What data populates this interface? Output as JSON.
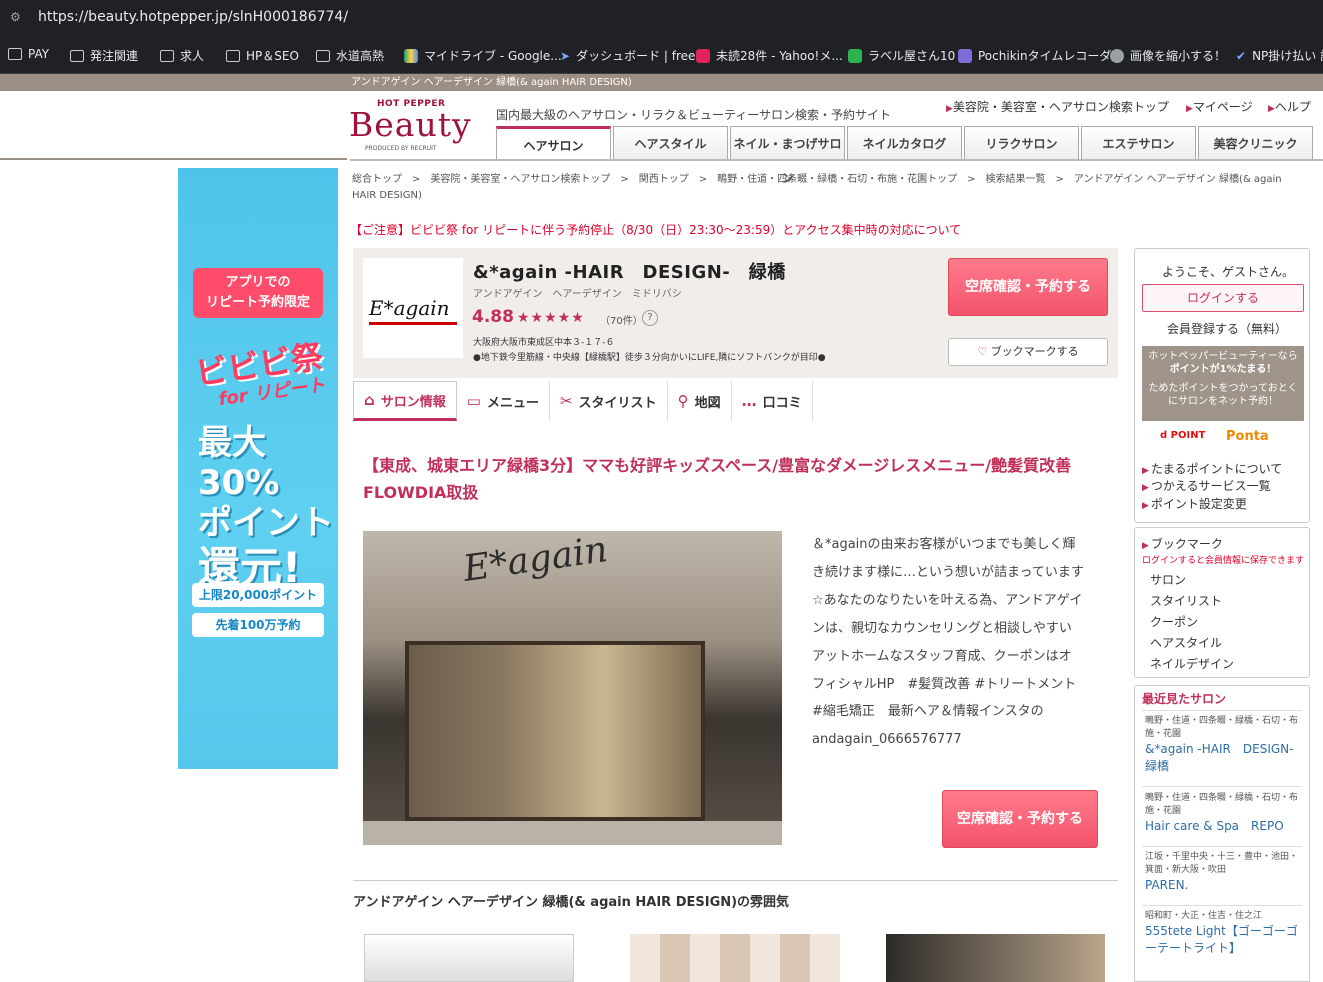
{
  "browser": {
    "url": "https://beauty.hotpepper.jp/slnH000186774/",
    "bookmarks": [
      "PAY",
      "発注関連",
      "求人",
      "HP＆SEO",
      "水道高熱",
      "マイドライブ - Google...",
      "ダッシュボード | freee",
      "未読28件 - Yahoo!メ...",
      "ラベル屋さん10",
      "Pochikinタイムレコーダー",
      "画像を縮小する！",
      "NP掛け払い 請"
    ]
  },
  "salon_bar": "アンドアゲイン ヘアーデザイン 緑橋(& again HAIR DESIGN)",
  "header": {
    "logo_top": "HOT PEPPER",
    "logo_main": "Beauty",
    "logo_produced": "PRODUCED BY RECRUIT",
    "tagline": "国内最大級のヘアサロン・リラク＆ビューティーサロン検索・予約サイト",
    "links": [
      "美容院・美容室・ヘアサロン検索トップ",
      "マイページ",
      "ヘルプ"
    ],
    "tabs": [
      "ヘアサロン",
      "ヘアスタイル",
      "ネイル・まつげサロン",
      "ネイルカタログ",
      "リラクサロン",
      "エステサロン",
      "美容クリニック"
    ]
  },
  "banner": {
    "pill": "アプリでの\nリピート予約限定",
    "fest": "ビビビ祭",
    "for": "for リピート",
    "big1": "最大30%",
    "big2": "ポイント",
    "big3": "還元!",
    "sub1": "上限20,000ポイント",
    "sub2": "先着100万予約"
  },
  "breadcrumb": "総合トップ　>　美容院・美容室・ヘアサロン検索トップ　>　関西トップ　>　鴫野・住道・四条畷・緑橋・石切・布施・花園トップ　>　検索結果一覧　>　アンドアゲイン ヘアーデザイン 緑橋(& again HAIR DESIGN)",
  "notice": "【ご注意】ビビビ祭 for リピートに伴う予約停止（8/30（日）23:30〜23:59）とアクセス集中時の対応について",
  "salon": {
    "logo_text": "E*again",
    "name": "&*again -HAIR　DESIGN-　緑橋",
    "kana": "アンドアゲイン　ヘアーデザイン　ミドリバシ",
    "rating": "4.88",
    "stars": "★★★★★",
    "count": "（70件）",
    "help": "?",
    "address": "大阪府大阪市東成区中本３-１７-６",
    "access": "●地下鉄今里筋線・中央線【緑橋駅】徒歩３分向かいにLIFE,隣にソフトバンクが目印●",
    "reserve": "空席確認・予約する",
    "bookmark": "ブックマークする"
  },
  "salon_tabs": [
    {
      "label": "サロン情報",
      "icon": "⌂"
    },
    {
      "label": "メニュー",
      "icon": "▭"
    },
    {
      "label": "スタイリスト",
      "icon": "✂"
    },
    {
      "label": "地図",
      "icon": "⚲"
    },
    {
      "label": "口コミ",
      "icon": "…"
    }
  ],
  "catch": "【東成、城東エリア緑橋3分】ママも好評キッズスペース/豊富なダメージレスメニュー/艶髪質改善FLOWDIA取扱",
  "photo_sign": "E*again",
  "description": "＆*againの由来お客様がいつまでも美しく輝き続けます様に…という想いが詰まっています☆あなたのなりたいを叶える為、アンドアゲインは、親切なカウンセリングと相談しやすいアットホームなスタッフ育成、クーポンはオフィシャルHP　#髪質改善 #トリートメント #縮毛矯正　最新ヘア＆情報インスタのandagain_0666576777",
  "atmosphere_title": "アンドアゲイン ヘアーデザイン 緑橋(& again HAIR DESIGN)の雰囲気",
  "sidebar": {
    "welcome": "ようこそ、ゲストさん。",
    "login": "ログインする",
    "register": "会員登録する（無料）",
    "points_promo": [
      "ホットペッパービューティーなら",
      "ポイントが1%たまる！",
      "ためたポイントをつかっておとく",
      "にサロンをネット予約！"
    ],
    "dpoint": "d POINT",
    "ponta": "Ponta",
    "point_links": [
      "たまるポイントについて",
      "つかえるサービス一覧",
      "ポイント設定変更"
    ],
    "bookmark_title": "ブックマーク",
    "bookmark_note": "ログインすると会員情報に保存できます",
    "bookmark_items": [
      "サロン",
      "スタイリスト",
      "クーポン",
      "ヘアスタイル",
      "ネイルデザイン"
    ],
    "recent_title": "最近見たサロン",
    "recent": [
      {
        "area": "鴫野・住道・四条畷・緑橋・石切・布施・花園",
        "name": "&*again -HAIR　DESIGN-　緑橋"
      },
      {
        "area": "鴫野・住道・四条畷・緑橋・石切・布施・花園",
        "name": "Hair care & Spa　REPO"
      },
      {
        "area": "江坂・千里中央・十三・豊中・池田・箕面・新大阪・吹田",
        "name": "PAREN."
      },
      {
        "area": "昭和町・大正・住吉・住之江",
        "name": "555tete Light【ゴーゴーゴーテートライト】"
      }
    ]
  }
}
